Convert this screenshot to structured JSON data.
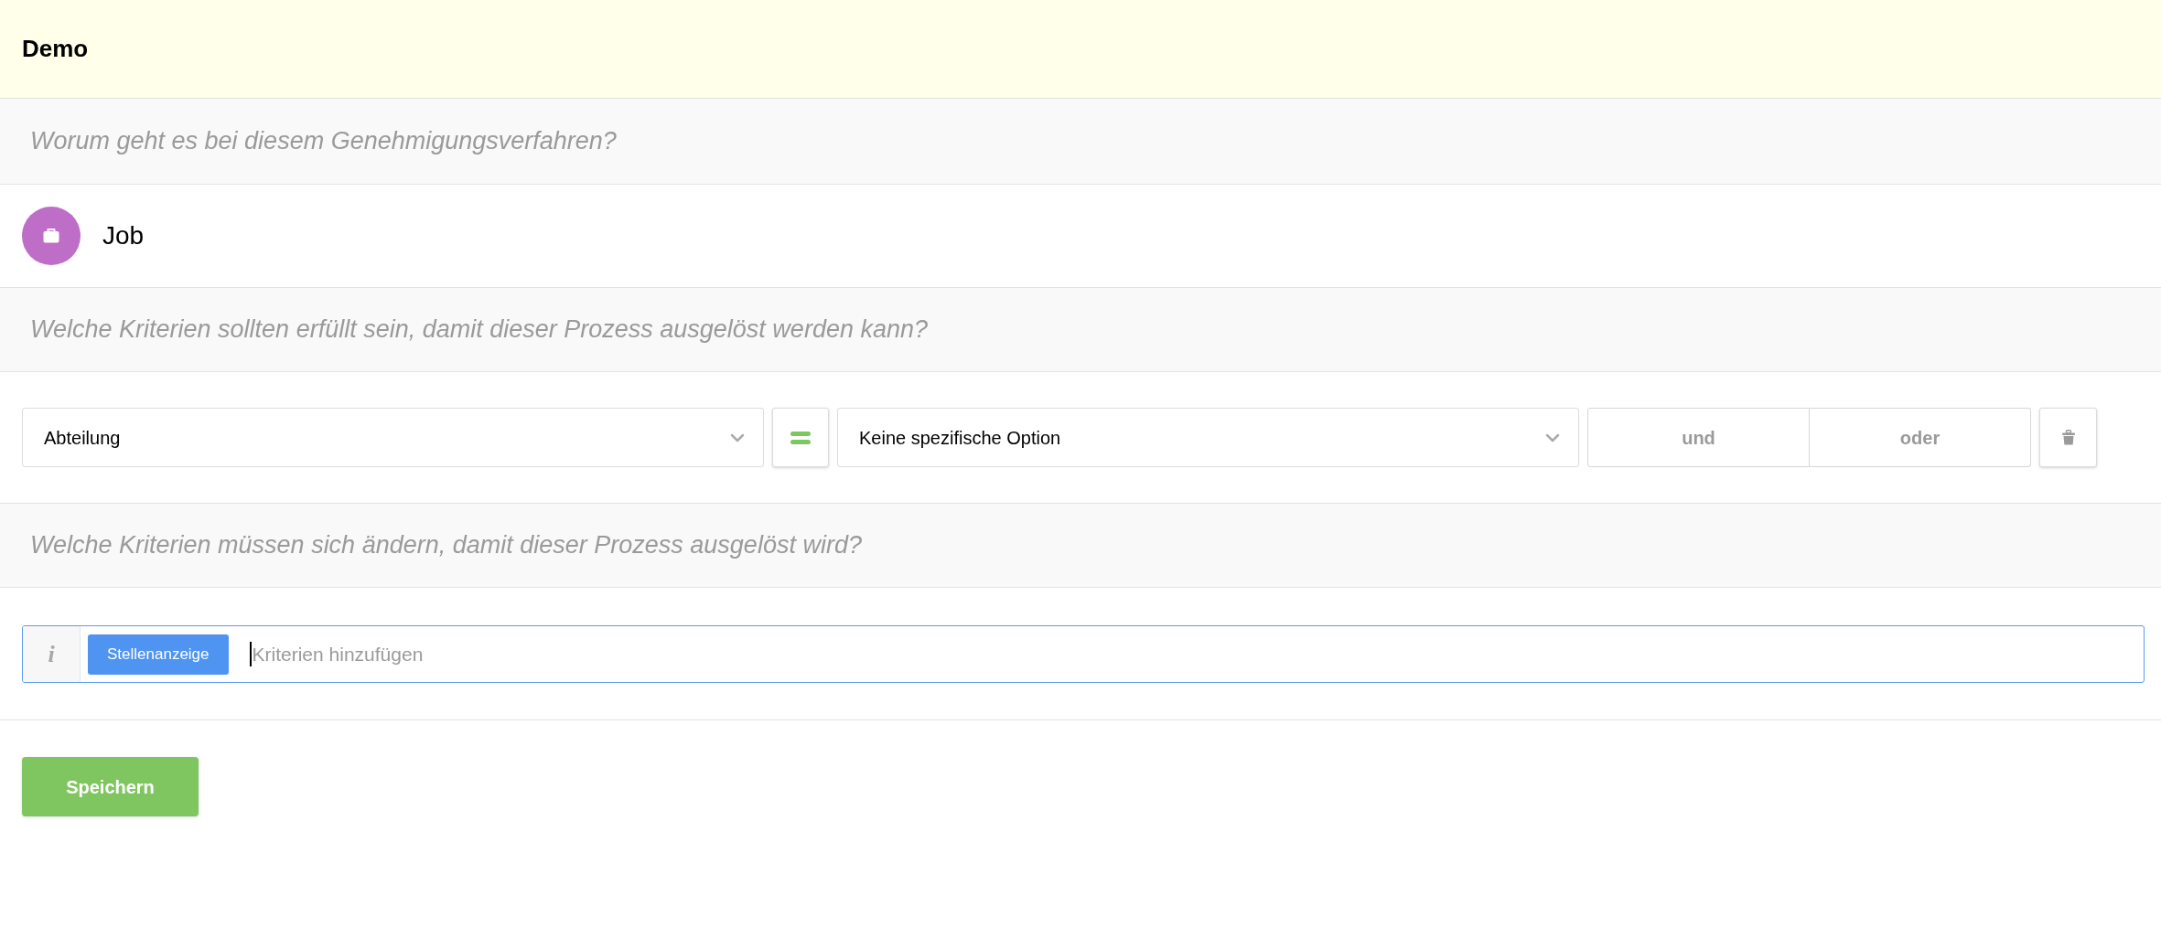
{
  "header": {
    "title": "Demo"
  },
  "subject_question": {
    "text": "Worum geht es bei diesem Genehmigungsverfahren?"
  },
  "subject": {
    "label": "Job"
  },
  "trigger_question": {
    "text": "Welche Kriterien sollten erfüllt sein, damit dieser Prozess ausgelöst werden kann?"
  },
  "trigger_criteria": [
    {
      "field": "Abteilung",
      "value": "Keine spezifische Option",
      "connectors": [
        {
          "label": "und",
          "selected": false
        },
        {
          "label": "oder",
          "selected": false
        }
      ]
    }
  ],
  "change_question": {
    "text": "Welche Kriterien müssen sich ändern, damit dieser Prozess ausgelöst wird?"
  },
  "change_criteria": {
    "info": "i",
    "tags": [
      {
        "label": "Stellenanzeige"
      }
    ],
    "placeholder": "Kriterien hinzufügen",
    "focused": true
  },
  "save_button": {
    "label": "Speichern"
  }
}
